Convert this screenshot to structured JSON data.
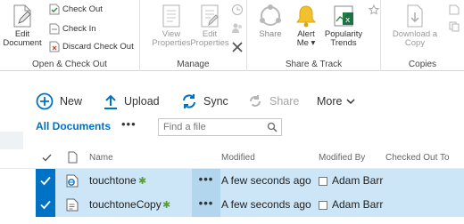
{
  "ribbon": {
    "edit_document": "Edit\nDocument",
    "edit_document_l1": "Edit",
    "edit_document_l2": "Document",
    "check_out": "Check Out",
    "check_in": "Check In",
    "discard_check_out": "Discard Check Out",
    "group_open_checkout": "Open & Check Out",
    "view_properties_l1": "View",
    "view_properties_l2": "Properties",
    "edit_properties_l1": "Edit",
    "edit_properties_l2": "Properties",
    "group_manage": "Manage",
    "share": "Share",
    "alert_me_l1": "Alert",
    "alert_me_l2": "Me ▾",
    "popularity_l1": "Popularity",
    "popularity_l2": "Trends",
    "group_share_track": "Share & Track",
    "download_l1": "Download a",
    "download_l2": "Copy",
    "group_copies": "Copies"
  },
  "commands": {
    "new": "New",
    "upload": "Upload",
    "sync": "Sync",
    "share": "Share",
    "more": "More"
  },
  "view": {
    "name": "All Documents",
    "more": "•••",
    "search_placeholder": "Find a file"
  },
  "table": {
    "headers": {
      "name": "Name",
      "modified": "Modified",
      "modified_by": "Modified By",
      "checked_out_to": "Checked Out To"
    },
    "rows": [
      {
        "name": "touchtone",
        "modified": "A few seconds ago",
        "modified_by": "Adam Barr",
        "ellipsis": "•••"
      },
      {
        "name": "touchtoneCopy",
        "modified": "A few seconds ago",
        "modified_by": "Adam Barr",
        "ellipsis": "•••"
      }
    ]
  },
  "colors": {
    "accent": "#0072c6",
    "row_selected": "#cde6f7",
    "new_marker": "#5a9e32"
  }
}
